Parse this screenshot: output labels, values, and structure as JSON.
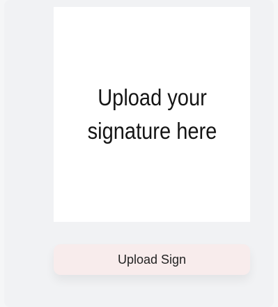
{
  "upload_area": {
    "prompt_line1": "Upload your",
    "prompt_line2": "signature here"
  },
  "upload_button": {
    "label": "Upload Sign"
  },
  "colors": {
    "page_background": "#f5f6f7",
    "card_background": "#f1f2f4",
    "upload_area_background": "#ffffff",
    "button_background": "#f8ecec",
    "text": "#151515"
  }
}
